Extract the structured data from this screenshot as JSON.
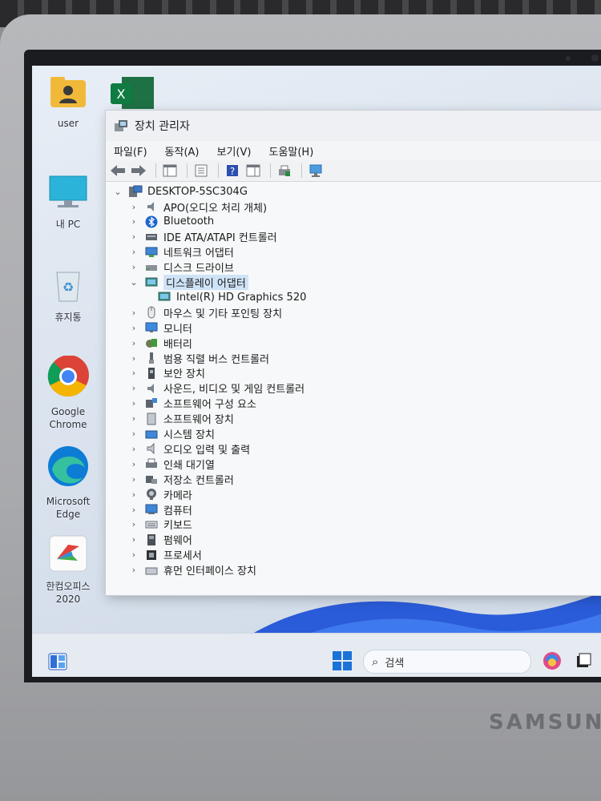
{
  "desktop": {
    "icons": [
      {
        "label": "user"
      },
      {
        "label": "내 PC"
      },
      {
        "label": "휴지통"
      },
      {
        "label": "Google Chrome"
      },
      {
        "label": "Microsoft Edge"
      },
      {
        "label": "한컴오피스 2020"
      }
    ]
  },
  "window": {
    "title": "장치 관리자",
    "menu": [
      "파일(F)",
      "동작(A)",
      "보기(V)",
      "도움말(H)"
    ],
    "tree": {
      "root": "DESKTOP-5SC304G",
      "items": [
        {
          "label": "APO(오디오 처리 개체)",
          "icon": "audio-icon"
        },
        {
          "label": "Bluetooth",
          "icon": "bluetooth-icon"
        },
        {
          "label": "IDE ATA/ATAPI 컨트롤러",
          "icon": "ide-controller-icon"
        },
        {
          "label": "네트워크 어댑터",
          "icon": "network-icon"
        },
        {
          "label": "디스크 드라이브",
          "icon": "disk-icon"
        },
        {
          "label": "디스플레이 어댑터",
          "icon": "display-adapter-icon",
          "expanded": true
        },
        {
          "label": "Intel(R) HD Graphics 520",
          "icon": "display-adapter-icon",
          "child": true
        },
        {
          "label": "마우스 및 기타 포인팅 장치",
          "icon": "mouse-icon"
        },
        {
          "label": "모니터",
          "icon": "monitor-icon"
        },
        {
          "label": "배터리",
          "icon": "battery-icon"
        },
        {
          "label": "범용 직렬 버스 컨트롤러",
          "icon": "usb-icon"
        },
        {
          "label": "보안 장치",
          "icon": "security-icon"
        },
        {
          "label": "사운드, 비디오 및 게임 컨트롤러",
          "icon": "sound-icon"
        },
        {
          "label": "소프트웨어 구성 요소",
          "icon": "software-component-icon"
        },
        {
          "label": "소프트웨어 장치",
          "icon": "software-device-icon"
        },
        {
          "label": "시스템 장치",
          "icon": "system-icon"
        },
        {
          "label": "오디오 입력 및 출력",
          "icon": "audio-io-icon"
        },
        {
          "label": "인쇄 대기열",
          "icon": "printer-icon"
        },
        {
          "label": "저장소 컨트롤러",
          "icon": "storage-icon"
        },
        {
          "label": "카메라",
          "icon": "camera-icon"
        },
        {
          "label": "컴퓨터",
          "icon": "computer-icon"
        },
        {
          "label": "키보드",
          "icon": "keyboard-icon"
        },
        {
          "label": "펌웨어",
          "icon": "firmware-icon"
        },
        {
          "label": "프로세서",
          "icon": "processor-icon"
        },
        {
          "label": "휴먼 인터페이스 장치",
          "icon": "hid-icon"
        }
      ]
    }
  },
  "taskbar": {
    "search_placeholder": "검색"
  },
  "laptop": {
    "brand": "SAMSUNG"
  }
}
